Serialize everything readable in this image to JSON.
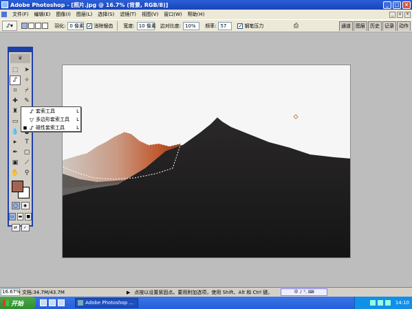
{
  "window": {
    "title": "Adobe Photoshop - [照片.jpg @ 16.7% (背景, RGB/8)]",
    "controls": {
      "minimize": "_",
      "maximize": "□",
      "close": "×"
    }
  },
  "menu": {
    "items": [
      "文件(F)",
      "编辑(E)",
      "图像(I)",
      "图层(L)",
      "选择(S)",
      "滤镜(T)",
      "视图(V)",
      "窗口(W)",
      "帮助(H)"
    ]
  },
  "options": {
    "feather_label": "羽化:",
    "feather_value": "0 像素",
    "antialias_label": "消除锯齿",
    "width_label": "宽度:",
    "width_value": "10 像素",
    "edge_contrast_label": "边对比度:",
    "edge_contrast_value": "10%",
    "frequency_label": "频率:",
    "frequency_value": "57",
    "pen_pressure_label": "钢笔压力",
    "palette_tabs": [
      "通道",
      "图层",
      "历史",
      "记录",
      "动作"
    ]
  },
  "tool_flyout": {
    "items": [
      {
        "label": "套索工具",
        "key": "L",
        "icon": "lasso-icon",
        "selected": false
      },
      {
        "label": "多边形套索工具",
        "key": "L",
        "icon": "polygonal-lasso-icon",
        "selected": false
      },
      {
        "label": "磁性套索工具",
        "key": "L",
        "icon": "magnetic-lasso-icon",
        "selected": true
      }
    ]
  },
  "toolbox": {
    "foreground_color": "#a26450",
    "background_color": "#ffffff"
  },
  "status": {
    "zoom": "16.67%",
    "doc_info": "文档:34.7M/43.7M",
    "hint": "点按以设置紧固点。要用附加选项，使用 Shift、Alt 和 Ctrl 键。",
    "ime": "中 ♪ °, ⌨"
  },
  "taskbar": {
    "start_label": "开始",
    "task_label": "Adobe Photoshop ...",
    "clock": "14:10"
  },
  "colors": {
    "titlebar": "#1a44b8",
    "taskbar": "#245edb",
    "start": "#2f8f2f",
    "workspace": "#bdbdbd",
    "chrome": "#ece9d8"
  }
}
